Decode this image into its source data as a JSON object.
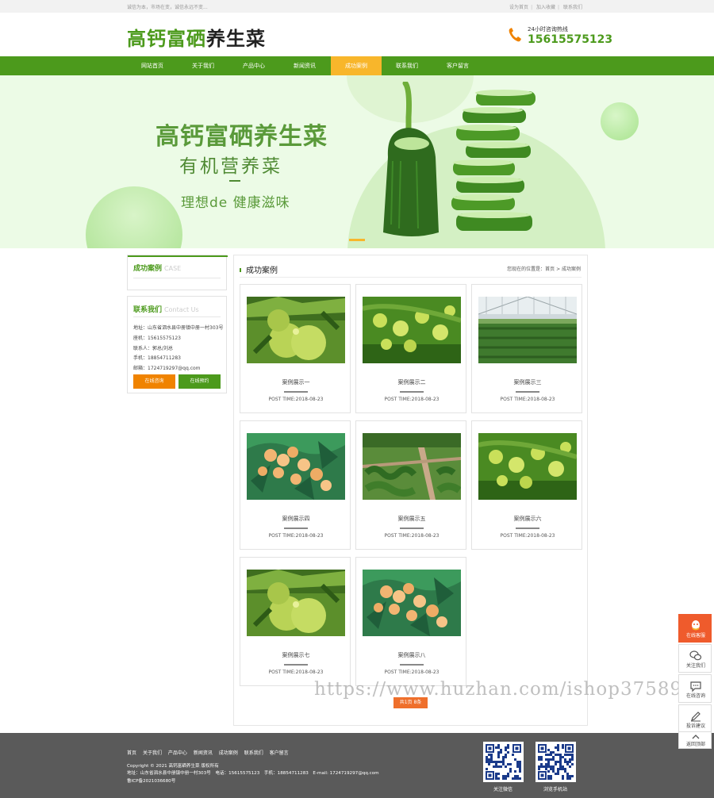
{
  "topbar": {
    "slogan": "诚信为本，市场在变，诚信永远不变...",
    "links": [
      "设为首页",
      "加入收藏",
      "联系我们"
    ]
  },
  "header": {
    "logo_green": "高钙富硒",
    "logo_dark": "养生菜",
    "hotline_label": "24小时咨询热线",
    "hotline_number": "15615575123"
  },
  "nav": {
    "items": [
      "网站首页",
      "关于我们",
      "产品中心",
      "新闻资讯",
      "成功案例",
      "联系我们",
      "客户留言"
    ],
    "active_index": 4
  },
  "banner": {
    "title": "高钙富硒养生菜",
    "subtitle": "有机营养菜",
    "tagline": "理想de 健康滋味"
  },
  "sidebar": {
    "case_box": {
      "title": "成功案例",
      "title_en": "CASE"
    },
    "contact_box": {
      "title": "联系我们",
      "title_en": "Contact Us",
      "lines": [
        "地址：山东省泗水县中册镇中册一村303号",
        "座机：15615575123",
        "联系人：郭总/刘总",
        "手机：18854711283",
        "邮箱：1724719297@qq.com"
      ],
      "btn_consult": "在线咨询",
      "btn_order": "在线预约"
    }
  },
  "main": {
    "title": "成功案例",
    "location": "您现在的位置是：首页 > 成功案例",
    "cards": [
      {
        "title": "案例展示一",
        "date": "POST TIME:2018-08-23",
        "img": "pomelo"
      },
      {
        "title": "案例展示二",
        "date": "POST TIME:2018-08-23",
        "img": "greenfruit"
      },
      {
        "title": "案例展示三",
        "date": "POST TIME:2018-08-23",
        "img": "greenhouse"
      },
      {
        "title": "案例展示四",
        "date": "POST TIME:2018-08-23",
        "img": "apricot"
      },
      {
        "title": "案例展示五",
        "date": "POST TIME:2018-08-23",
        "img": "garden"
      },
      {
        "title": "案例展示六",
        "date": "POST TIME:2018-08-23",
        "img": "greenfruit"
      },
      {
        "title": "案例展示七",
        "date": "POST TIME:2018-08-23",
        "img": "pomelo"
      },
      {
        "title": "案例展示八",
        "date": "POST TIME:2018-08-23",
        "img": "apricot"
      }
    ],
    "pager": "共1页 8条"
  },
  "watermark": "https://www.huzhan.com/ishop37589",
  "footer": {
    "nav": [
      "首页",
      "关于我们",
      "产品中心",
      "新闻资讯",
      "成功案例",
      "联系我们",
      "客户留言"
    ],
    "copyright": "Copyright © 2021 高钙富硒养生菜 版权所有",
    "address": "地址：山东省泗水县中册镇中册一村303号　电话：15615575123　手机：18854711283　E-mail: 1724719297@qq.com",
    "icp": "鲁ICP备2021036680号",
    "qr_wechat": "关注微信",
    "qr_mobile": "浏览手机站"
  },
  "float_bar": [
    "在线客服",
    "关注我们",
    "在线咨询",
    "投诉建议",
    "返回顶部"
  ],
  "colors": {
    "brand_green": "#4c9a1c",
    "accent_yellow": "#f8b62b",
    "orange": "#f08300",
    "footer_gray": "#5a5a5a"
  }
}
